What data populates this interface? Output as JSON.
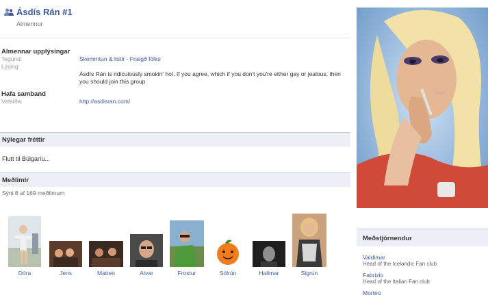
{
  "header": {
    "title": "Ásdís Rán #1",
    "category": "Almennur"
  },
  "general_info": {
    "heading": "Almennar upplýsingar",
    "type_label": "Tegund:",
    "type_value": "Skemmtun & listir - Frægð fólks",
    "description_label": "Lýsing:",
    "description_value": "Ásdís Rán is ridiculously smokin' hot. If you agree, which if you don't you're either gay or jealous, then you should join this group"
  },
  "contact": {
    "heading": "Hafa samband",
    "website_label": "Vefsíða:",
    "website_value": "http://asdisran.com/"
  },
  "news": {
    "heading": "Nýlegar fréttir",
    "text": "Flutt til Búlgaríu..."
  },
  "members": {
    "heading": "Meðlimir",
    "count_text": "Sýni 8 af 169 meðlimum",
    "list": [
      {
        "name": "Dóra"
      },
      {
        "name": "Jens"
      },
      {
        "name": "Matteo"
      },
      {
        "name": "Atvar"
      },
      {
        "name": "Frostur"
      },
      {
        "name": "Sólrún"
      },
      {
        "name": "Hallmar"
      },
      {
        "name": "Sigrún"
      }
    ]
  },
  "admins": {
    "heading": "Meðstjórnendur",
    "list": [
      {
        "name": "Valdimar",
        "desc": "Head of the Icelandic Fan club"
      },
      {
        "name": "Fabrizio",
        "desc": "Head of the Italian Fan club"
      },
      {
        "name": "Morteo",
        "desc": ""
      }
    ]
  },
  "colors": {
    "link": "#3b5998",
    "bar_bg": "#eceff5"
  }
}
